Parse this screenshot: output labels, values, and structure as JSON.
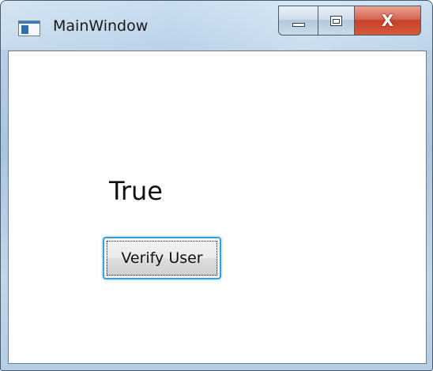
{
  "window": {
    "title": "MainWindow",
    "icon": "app-window-icon",
    "controls": {
      "minimize_icon": "minimize-icon",
      "maximize_icon": "maximize-icon",
      "close_label": "X"
    }
  },
  "content": {
    "status_text": "True",
    "verify_button_label": "Verify User"
  },
  "colors": {
    "focus_accent": "#3c9fd6",
    "close_button": "#c4412a"
  }
}
